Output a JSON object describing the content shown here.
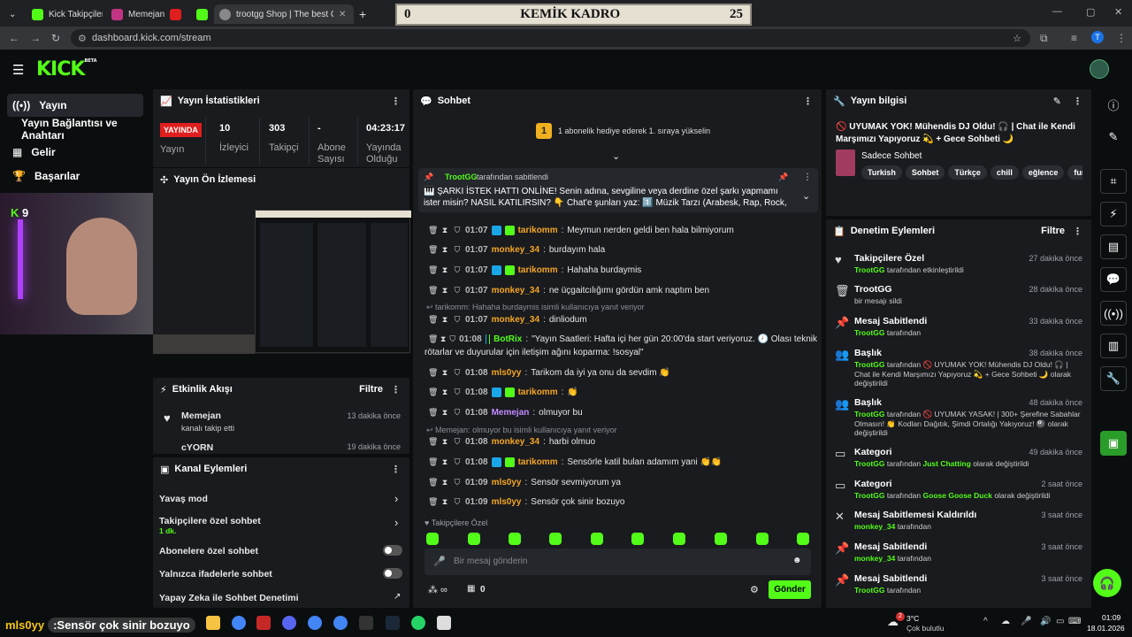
{
  "browser": {
    "tabs": [
      {
        "label": "Kick Takipçiler"
      },
      {
        "label": "Memejan"
      },
      {
        "label": ""
      },
      {
        "label": ""
      },
      {
        "label": ""
      },
      {
        "label": "trootgg Shop | The best ChatBot"
      }
    ],
    "url": "dashboard.kick.com/stream",
    "profile_initial": "T"
  },
  "scoreboard": {
    "left": "0",
    "title": "KEMİK KADRO",
    "right": "25"
  },
  "sidebar": {
    "items": [
      {
        "label": "Yayın"
      },
      {
        "label": "Yayın Bağlantısı ve Anahtarı"
      },
      {
        "label": "Gelir"
      },
      {
        "label": "Başarılar"
      }
    ],
    "kick_count": "9"
  },
  "stats": {
    "title": "Yayın İstatistikleri",
    "live_label": "YAYINDA",
    "live_sub": "Yayın",
    "viewers": "10",
    "viewers_label": "İzleyici",
    "followers": "303",
    "followers_label": "Takipçi",
    "subs": "-",
    "subs_label": "Abone Sayısı",
    "uptime": "04:23:17",
    "uptime_label": "Yayında Olduğu"
  },
  "preview": {
    "title": "Yayın Ön İzlemesi"
  },
  "activity": {
    "title": "Etkinlik Akışı",
    "filter": "Filtre",
    "items": [
      {
        "user": "Memejan",
        "action": "kanalı takip etti",
        "time": "13 dakika önce"
      },
      {
        "user": "cYORN",
        "action": "",
        "time": "19 dakika önce"
      }
    ]
  },
  "channel_actions": {
    "title": "Kanal Eylemleri",
    "slow_mode": "Yavaş mod",
    "followers_only": "Takipçilere özel sohbet",
    "followers_only_sub": "1 dk.",
    "subs_only": "Abonelere özel sohbet",
    "emotes_only": "Yalnızca ifadelerle sohbet",
    "ai_mod": "Yapay Zeka ile Sohbet Denetimi"
  },
  "chat": {
    "title": "Sohbet",
    "gift_rank": "1",
    "gift_text": "1 abonelik hediye ederek 1. sıraya yükselin",
    "pinned_by": "TrootGG",
    "pinned_by_suffix": "tarafından sabitlendi",
    "pinned_text": "🎹 ŞARKI İSTEK HATTI ONLİNE! Senin adına, sevgiline veya derdine özel şarkı yapmamı ister misin? NASIL KATILIRSIN? 👇 Chat'e şunları yaz: 1️⃣ Müzik Tarzı (Arabesk, Rap, Rock, Pop.....",
    "messages": [
      {
        "time": "01:07",
        "user": "tarikomm",
        "color": "#f5a623",
        "text": "Meymun nerden geldi ben hala bilmiyorum",
        "badges": 2
      },
      {
        "time": "01:07",
        "user": "monkey_34",
        "color": "#f5a623",
        "text": "burdayım hala",
        "badges": 0
      },
      {
        "time": "01:07",
        "user": "tarikomm",
        "color": "#f5a623",
        "text": "Hahaha burdaymis",
        "badges": 2
      },
      {
        "time": "01:07",
        "user": "monkey_34",
        "color": "#f5a623",
        "text": "ne üçgaitcılığımı gördün amk naptım ben",
        "badges": 0
      },
      {
        "time": "01:07",
        "user": "monkey_34",
        "color": "#f5a623",
        "text": "dinliodum",
        "badges": 0
      },
      {
        "time": "01:08",
        "user": "BotRix",
        "color": "#53fc18",
        "text": "\"Yayın Saatleri: Hafta içi her gün 20:00'da start veriyoruz. 🕗 Olası teknik",
        "text2": "rötarlar ve duyurular için iletişim ağını koparma: !sosyal\"",
        "badges": 2
      },
      {
        "time": "01:08",
        "user": "mls0yy",
        "color": "#f5a623",
        "text": "Tarikom da iyi ya onu da sevdim 👏",
        "badges": 0
      },
      {
        "time": "01:08",
        "user": "tarikomm",
        "color": "#f5a623",
        "text": "👏",
        "badges": 2
      },
      {
        "time": "01:08",
        "user": "Memejan",
        "color": "#c08bff",
        "text": "olmuyor bu",
        "badges": 0
      },
      {
        "time": "01:08",
        "user": "monkey_34",
        "color": "#f5a623",
        "text": "harbi olmuo",
        "badges": 0
      },
      {
        "time": "01:08",
        "user": "tarikomm",
        "color": "#f5a623",
        "text": "Sensörle katil bulan adamım yani 👏👏",
        "badges": 2
      },
      {
        "time": "01:09",
        "user": "mls0yy",
        "color": "#f5a623",
        "text": "Sensör sevmiyorum ya",
        "badges": 0
      },
      {
        "time": "01:09",
        "user": "mls0yy",
        "color": "#f5a623",
        "text": "Sensör çok sinir bozuyo",
        "badges": 0
      }
    ],
    "reply1": "tarikomm: Hahaha burdaymis isimli kullanıcıya yanıt veriyor",
    "reply2": "Memejan: olmuyor bu isimli kullanıcıya yanıt veriyor",
    "followers_only_label": "Takipçilere Özel",
    "input_placeholder": "Bir mesaj gönderin",
    "points": "0",
    "send": "Gönder"
  },
  "stream_info": {
    "title": "Yayın bilgisi",
    "stream_title": "🚫 UYUMAK YOK! Mühendis DJ Oldu! 🎧 | Chat ile Kendi Marşımızı Yapıyoruz 💫 + Gece Sohbeti 🌙",
    "category": "Sadece Sohbet",
    "tags": [
      "Turkish",
      "Sohbet",
      "Türkçe",
      "chill",
      "eğlence",
      "funny"
    ]
  },
  "mod_log": {
    "title": "Denetim Eylemleri",
    "filter": "Filtre",
    "items": [
      {
        "title": "Takipçilere Özel",
        "who": "TrootGG",
        "sub": "tarafından etkinleştirildi",
        "time": "27 dakika önce",
        "icon": "♥"
      },
      {
        "title": "TrootGG",
        "who": "",
        "sub": "bir mesajı sildi",
        "time": "28 dakika önce",
        "icon": "🗑"
      },
      {
        "title": "Mesaj Sabitlendi",
        "who": "TrootGG",
        "sub": "tarafından",
        "time": "33 dakika önce",
        "icon": "📌"
      },
      {
        "title": "Başlık",
        "who": "TrootGG",
        "sub": "tarafından 🚫 UYUMAK YOK! Mühendis DJ Oldu! 🎧 | Chat ile Kendi Marşımızı Yapıyoruz 💫 + Gece Sohbeti 🌙 olarak değiştirildi",
        "time": "38 dakika önce",
        "icon": "👥"
      },
      {
        "title": "Başlık",
        "who": "TrootGG",
        "sub": "tarafından 🚫 UYUMAK YASAK! | 300+ Şerefine Sabahlar Olmasın! 👏 Kodları Dağıtık, Şimdi Ortalığı Yakıyoruz! 🎱 olarak değiştirildi",
        "time": "48 dakika önce",
        "icon": "👥"
      },
      {
        "title": "Kategori",
        "who": "TrootGG",
        "sub": "tarafından",
        "cat": "Just Chatting",
        "sub2": "olarak değiştirildi",
        "time": "49 dakika önce",
        "icon": "▭"
      },
      {
        "title": "Kategori",
        "who": "TrootGG",
        "sub": "tarafından",
        "cat": "Goose Goose Duck",
        "sub2": "olarak değiştirildi",
        "time": "2 saat önce",
        "icon": "▭"
      },
      {
        "title": "Mesaj Sabitlemesi Kaldırıldı",
        "who": "monkey_34",
        "sub": "tarafından",
        "time": "3 saat önce",
        "icon": "✕"
      },
      {
        "title": "Mesaj Sabitlendi",
        "who": "monkey_34",
        "sub": "tarafından",
        "time": "3 saat önce",
        "icon": "📌"
      },
      {
        "title": "Mesaj Sabitlendi",
        "who": "TrootGG",
        "sub": "tarafından",
        "time": "3 saat önce",
        "icon": "📌"
      }
    ]
  },
  "overlay_caption": {
    "user": "mls0yy",
    "text": ":Sensör çok sinir bozuyo"
  },
  "taskbar": {
    "weather_temp": "3°C",
    "weather_text": "Çok bulutlu",
    "weather_badge": "2",
    "time": "01:09",
    "date": "18.01.2026"
  },
  "colors": {
    "accent": "#53fc18",
    "live": "#e01e1e",
    "panel": "#191b1f"
  }
}
